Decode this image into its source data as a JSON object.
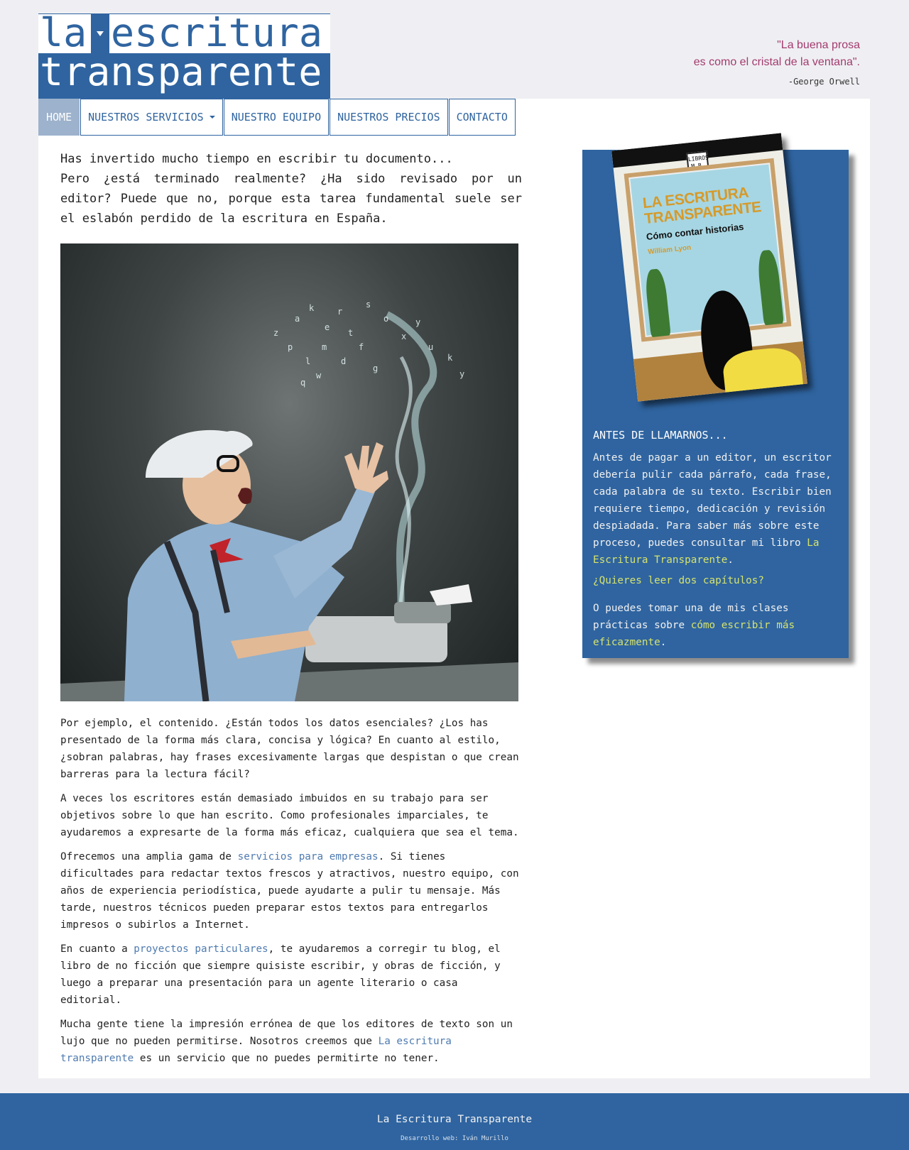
{
  "logo": {
    "line1_pre": "la",
    "line1_post": "escritura",
    "line2": "transparente"
  },
  "quote": {
    "line1": "\"La buena prosa",
    "line2": "es como el cristal de la ventana\".",
    "author": "-George Orwell"
  },
  "nav": {
    "items": [
      {
        "label": "HOME",
        "active": true
      },
      {
        "label": "NUESTROS SERVICIOS",
        "dropdown": true
      },
      {
        "label": "NUESTRO EQUIPO"
      },
      {
        "label": "NUESTROS PRECIOS"
      },
      {
        "label": "CONTACTO"
      }
    ]
  },
  "intro": {
    "line1": "Has invertido mucho tiempo en escribir tu documento...",
    "line2": "Pero ¿está terminado realmente? ¿Ha sido revisado por un editor? Puede que no, porque esta tarea fundamental suele ser el eslabón perdido de la escritura en España."
  },
  "body": {
    "p1": "Por ejemplo, el contenido. ¿Están todos los datos esenciales? ¿Los has presentado de la forma más clara, concisa y lógica? En cuanto al estilo, ¿sobran palabras, hay frases excesivamente largas que despistan o que crean barreras para la lectura fácil?",
    "p2": "A veces los escritores están demasiado imbuidos en su trabajo para ser objetivos sobre lo que han escrito. Como profesionales imparciales, te ayudaremos a expresarte de la forma más eficaz, cualquiera que sea el tema.",
    "p3_pre": "Ofrecemos una amplia gama de ",
    "p3_link": "servicios para empresas",
    "p3_post": ". Si tienes dificultades para redactar textos frescos y atractivos, nuestro equipo, con años de experiencia periodística, puede ayudarte a pulir tu mensaje. Más tarde, nuestros técnicos pueden preparar estos textos para entregarlos impresos o subirlos a Internet.",
    "p4_pre": "En cuanto a ",
    "p4_link": "proyectos particulares",
    "p4_post": ", te ayudaremos a corregir tu blog, el libro de no ficción que siempre quisiste escribir, y obras de ficción, y luego a preparar una presentación para un agente literario o casa editorial.",
    "p5_pre": "Mucha gente tiene la impresión errónea de que los editores de texto son un lujo que no pueden permitirse. Nosotros creemos que ",
    "p5_link": "La escritura transparente",
    "p5_post": " es un servicio que no puedes permitirte no tener."
  },
  "book": {
    "badge": "LIBROS M.B.",
    "title": "LA ESCRITURA TRANSPARENTE",
    "subtitle": "Cómo contar historias",
    "author": "William Lyon"
  },
  "sidebar": {
    "heading": "ANTES DE LLAMARNOS...",
    "p1_pre": "Antes de pagar a un editor, un escritor debería pulir cada párrafo, cada frase, cada palabra de su texto. Escribir bien requiere tiempo, dedicación y revisión despiadada. Para saber más sobre este proceso, puedes consultar mi libro ",
    "p1_link": "La Escritura Transparente",
    "p1_post": ".",
    "chapters_link": "¿Quieres leer dos capítulos?",
    "p2_pre": "O puedes tomar una de mis clases prácticas sobre ",
    "p2_link": "cómo escribir más eficazmente",
    "p2_post": "."
  },
  "footer": {
    "name": "La Escritura Transparente",
    "dev": "Desarrollo web: Iván Murillo"
  },
  "colors": {
    "brand_blue": "#2f64a0",
    "quote_magenta": "#a33b6e",
    "sidebar_link": "#d6e36b",
    "body_link": "#4f7bb0"
  }
}
